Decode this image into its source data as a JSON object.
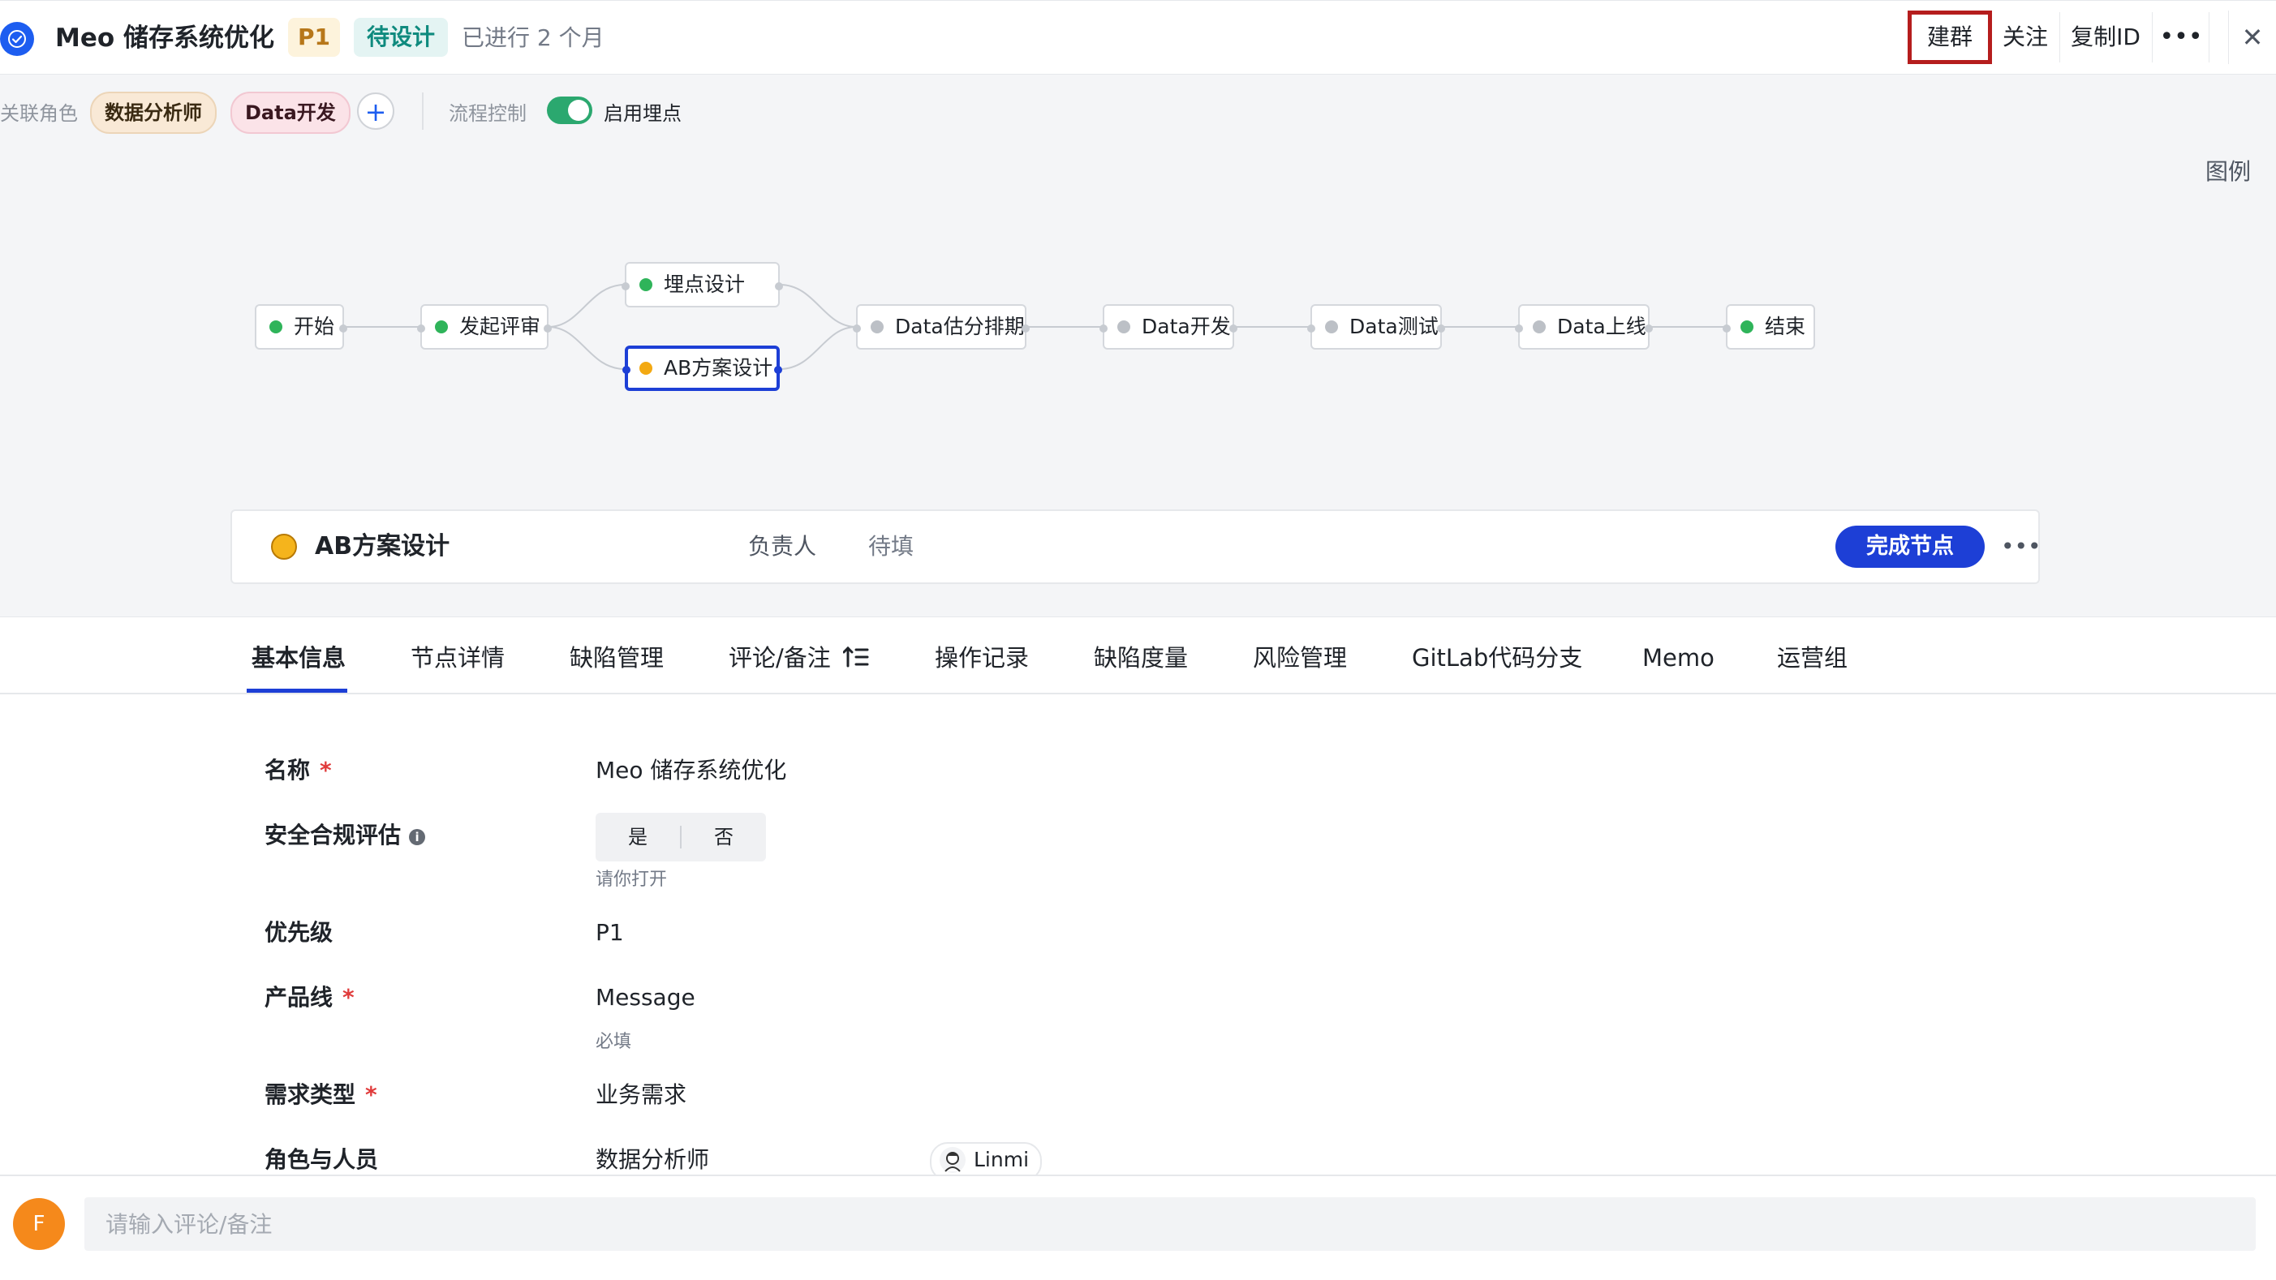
{
  "header": {
    "title": "Meo 储存系统优化",
    "priority": "P1",
    "state": "待设计",
    "duration": "已进行 2 个月",
    "actions": {
      "create_group": "建群",
      "follow": "关注",
      "copy_id": "复制ID",
      "more": "•••",
      "close": "✕"
    }
  },
  "toolbar": {
    "roles_label": "关联角色",
    "roles": [
      "数据分析师",
      "Data开发"
    ],
    "add": "+",
    "flow_control_label": "流程控制",
    "tracking_toggle_label": "启用埋点",
    "tracking_enabled": true,
    "legend": "图例"
  },
  "flow": {
    "nodes": [
      {
        "label": "开始",
        "status": "done"
      },
      {
        "label": "发起评审",
        "status": "done"
      },
      {
        "label": "埋点设计",
        "status": "done"
      },
      {
        "label": "AB方案设计",
        "status": "in_progress"
      },
      {
        "label": "Data估分排期",
        "status": "pending"
      },
      {
        "label": "Data开发",
        "status": "pending"
      },
      {
        "label": "Data测试",
        "status": "pending"
      },
      {
        "label": "Data上线",
        "status": "pending"
      },
      {
        "label": "结束",
        "status": "done"
      }
    ],
    "status_colors": {
      "done": "#2fb45a",
      "in_progress": "#f3a912",
      "pending": "#bcc0c6"
    },
    "active_color": "#1d3fd6"
  },
  "node_card": {
    "title": "AB方案设计",
    "owner_label": "负责人",
    "owner_value": "待填",
    "complete_button": "完成节点",
    "more": "•••"
  },
  "tabs": [
    {
      "label": "基本信息",
      "selected": true
    },
    {
      "label": "节点详情"
    },
    {
      "label": "缺陷管理"
    },
    {
      "label": "评论/备注"
    },
    {
      "label": "操作记录"
    },
    {
      "label": "缺陷度量"
    },
    {
      "label": "风险管理"
    },
    {
      "label": "GitLab代码分支"
    },
    {
      "label": "Memo"
    },
    {
      "label": "运营组"
    }
  ],
  "form": {
    "name_label": "名称",
    "name_value": "Meo 储存系统优化",
    "compliance_label": "安全合规评估",
    "compliance_info_icon": "i",
    "compliance_options": [
      "是",
      "否"
    ],
    "compliance_hint": "请你打开",
    "priority_label": "优先级",
    "priority_value": "P1",
    "product_line_label": "产品线",
    "product_line_value": "Message",
    "product_line_hint": "必填",
    "req_type_label": "需求类型",
    "req_type_value": "业务需求",
    "roles_label": "角色与人员",
    "role_name": "数据分析师",
    "role_person": "Linmi",
    "required_mark": "*"
  },
  "comment": {
    "avatar_letter": "F",
    "placeholder": "请输入评论/备注"
  }
}
